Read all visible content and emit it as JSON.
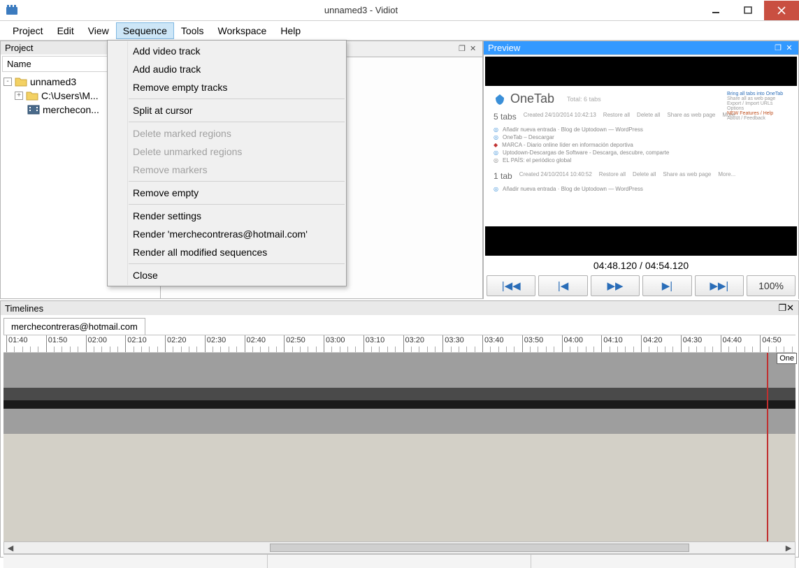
{
  "window": {
    "title": "unnamed3 - Vidiot"
  },
  "menubar": {
    "items": [
      "Project",
      "Edit",
      "View",
      "Sequence",
      "Tools",
      "Workspace",
      "Help"
    ],
    "active_index": 3
  },
  "dropdown": {
    "items": [
      {
        "label": "Add video track",
        "enabled": true
      },
      {
        "label": "Add audio track",
        "enabled": true
      },
      {
        "label": "Remove empty tracks",
        "enabled": true
      },
      {
        "label": "---"
      },
      {
        "label": "Split at cursor",
        "enabled": true
      },
      {
        "label": "---"
      },
      {
        "label": "Delete marked regions",
        "enabled": false
      },
      {
        "label": "Delete unmarked regions",
        "enabled": false
      },
      {
        "label": "Remove markers",
        "enabled": false
      },
      {
        "label": "---"
      },
      {
        "label": "Remove empty",
        "enabled": true
      },
      {
        "label": "---"
      },
      {
        "label": "Render settings",
        "enabled": true
      },
      {
        "label": "Render 'merchecontreras@hotmail.com'",
        "enabled": true
      },
      {
        "label": "Render all modified sequences",
        "enabled": true
      },
      {
        "label": "---"
      },
      {
        "label": "Close",
        "enabled": true
      }
    ]
  },
  "project_panel": {
    "title": "Project",
    "column_header": "Name",
    "tree": [
      {
        "label": "unnamed3",
        "indent": 0,
        "icon": "folder",
        "expander": "-"
      },
      {
        "label": "C:\\Users\\M...",
        "indent": 1,
        "icon": "folder",
        "expander": "+"
      },
      {
        "label": "merchecon...",
        "indent": 2,
        "icon": "sequence",
        "expander": ""
      }
    ]
  },
  "preview_panel": {
    "title": "Preview",
    "content": {
      "logo_text": "OneTab",
      "subtitle": "Total: 6 tabs",
      "right_box": [
        "Bring all tabs into OneTab",
        "Share all as web page",
        "Export / Import URLs",
        "Options",
        "NEW Features / Help",
        "About / Feedback"
      ],
      "section1_title": "5 tabs",
      "section1_meta": [
        "Created 24/10/2014 10:42:13",
        "Restore all",
        "Delete all",
        "Share as web page",
        "More..."
      ],
      "section1_items": [
        "Añadir nueva entrada · Blog de Uptodown — WordPress",
        "OneTab – Descargar",
        "MARCA - Diario online líder en información deportiva",
        "Uptodown-Descargas de Software - Descarga, descubre, comparte",
        "EL PAÍS: el periódico global"
      ],
      "section2_title": "1 tab",
      "section2_meta": [
        "Created 24/10/2014 10:40:52",
        "Restore all",
        "Delete all",
        "Share as web page",
        "More..."
      ],
      "section2_items": [
        "Añadir nueva entrada · Blog de Uptodown — WordPress"
      ]
    },
    "time": "04:48.120 / 04:54.120",
    "zoom": "100%"
  },
  "timelines_panel": {
    "title": "Timelines",
    "tab": "merchecontreras@hotmail.com",
    "ruler": [
      "01:40",
      "01:50",
      "02:00",
      "02:10",
      "02:20",
      "02:30",
      "02:40",
      "02:50",
      "03:00",
      "03:10",
      "03:20",
      "03:30",
      "03:40",
      "03:50",
      "04:00",
      "04:10",
      "04:20",
      "04:30",
      "04:40",
      "04:50"
    ],
    "clip_label": "One"
  }
}
